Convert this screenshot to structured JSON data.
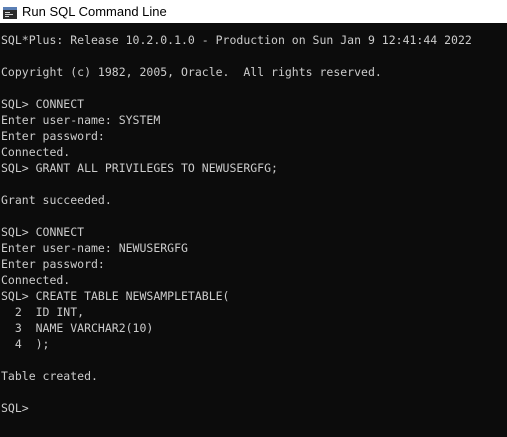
{
  "window": {
    "title": "Run SQL Command Line",
    "icon": "sql-command-line-icon"
  },
  "colors": {
    "console_background": "#0c0c0c",
    "console_text": "#cccccc",
    "titlebar_background": "#ffffff",
    "titlebar_text": "#000000"
  },
  "console": {
    "lines": [
      "SQL*Plus: Release 10.2.0.1.0 - Production on Sun Jan 9 12:41:44 2022",
      "",
      "Copyright (c) 1982, 2005, Oracle.  All rights reserved.",
      "",
      "SQL> CONNECT",
      "Enter user-name: SYSTEM",
      "Enter password:",
      "Connected.",
      "SQL> GRANT ALL PRIVILEGES TO NEWUSERGFG;",
      "",
      "Grant succeeded.",
      "",
      "SQL> CONNECT",
      "Enter user-name: NEWUSERGFG",
      "Enter password:",
      "Connected.",
      "SQL> CREATE TABLE NEWSAMPLETABLE(",
      "  2  ID INT,",
      "  3  NAME VARCHAR2(10)",
      "  4  );",
      "",
      "Table created.",
      "",
      "SQL>"
    ]
  }
}
